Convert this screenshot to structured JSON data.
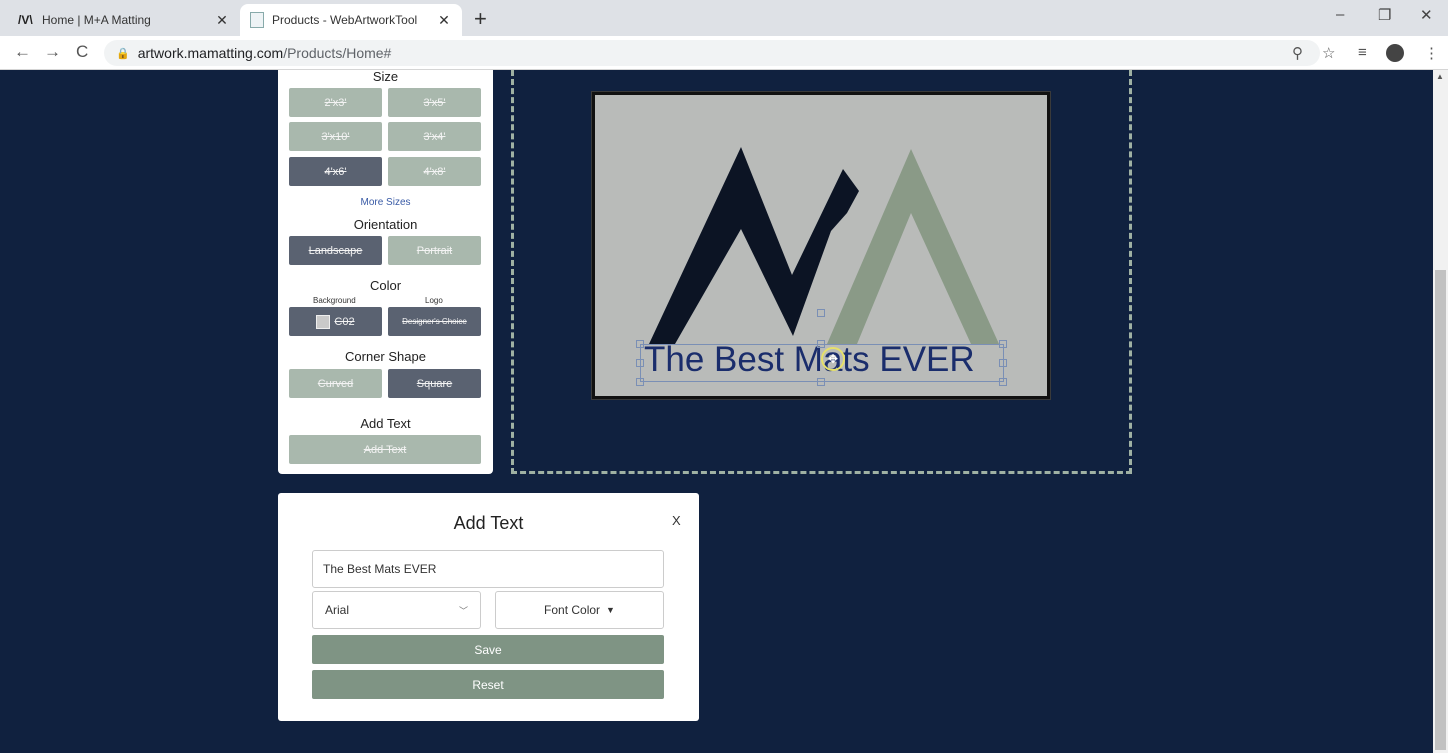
{
  "browser": {
    "tabs": [
      {
        "title": "Home | M+A Matting",
        "favicon": "ma-logo-icon"
      },
      {
        "title": "Products - WebArtworkTool",
        "favicon": "document-icon"
      }
    ],
    "new_tab_icon": "+",
    "minimize_icon": "–",
    "restore_icon": "❐",
    "close_icon": "✕",
    "tab_close_icon": "✕",
    "back_icon": "←",
    "forward_icon": "→",
    "reload_icon": "C",
    "url_host": "artwork.mamatting.com",
    "url_path": "/Products/Home#",
    "zoom_icon": "⚲",
    "star_icon": "☆",
    "menu_icon": "⋮",
    "media_icon": "≡"
  },
  "panel": {
    "size_title": "Size",
    "sizes": [
      "2'x3'",
      "3'x5'",
      "3'x10'",
      "3'x4'",
      "4'x6'",
      "4'x8'"
    ],
    "selected_size": "4'x6'",
    "more_sizes": "More Sizes",
    "orientation_title": "Orientation",
    "orientations": [
      "Landscape",
      "Portrait"
    ],
    "color_title": "Color",
    "background_label": "Background",
    "logo_label": "Logo",
    "background_value": "C02",
    "logo_value": "Designer's Choice",
    "corner_title": "Corner Shape",
    "corners": [
      "Curved",
      "Square"
    ],
    "add_text_title": "Add Text",
    "add_text_button": "Add Text"
  },
  "mat": {
    "text": "The Best Mats EVER",
    "colors": {
      "dark_peak": "#0c1424",
      "light_peak": "#8a9a87",
      "background": "#b9bbb9",
      "text": "#1a2d6c"
    }
  },
  "modal": {
    "title": "Add Text",
    "close": "X",
    "text_value": "The Best Mats EVER",
    "font": "Arial",
    "font_color_label": "Font Color",
    "save_label": "Save",
    "reset_label": "Reset"
  },
  "colors": {
    "page_bg": "#10213f",
    "accent_green": "#7f9484",
    "dark_option": "#5a6271",
    "light_option": "#a9b8ad"
  }
}
